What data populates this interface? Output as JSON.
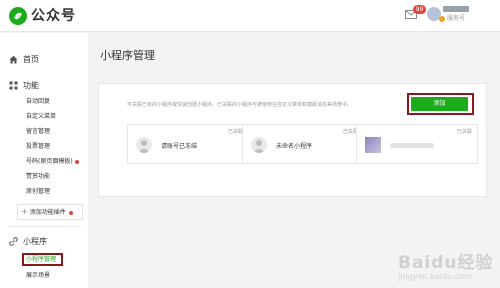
{
  "header": {
    "brand": "公众号",
    "mail_badge": "99",
    "account_type": "服务号"
  },
  "sidebar": {
    "home": "首页",
    "functions": {
      "title": "功能",
      "items": [
        "自动回复",
        "自定义菜单",
        "留言管理",
        "投票管理",
        "号码(原页面模板)",
        "赞赏功能",
        "原创管理"
      ]
    },
    "add_plugin": "添加功能插件",
    "miniprogram": {
      "title": "小程序",
      "items": [
        "小程序管理",
        "展示场景"
      ]
    }
  },
  "main": {
    "title": "小程序管理",
    "description": "可关联已有的小程序或快速创建小程序。已关联的小程序可被使用在自定义菜单和模版消息等场景中。",
    "add_button": "添加",
    "cards": [
      {
        "status": "已关联",
        "name": "请账号已冻结"
      },
      {
        "status": "已关联",
        "name": "未命名小程序"
      },
      {
        "status": "已关联"
      }
    ]
  },
  "watermark": {
    "text": "Baidu经验",
    "url": "jingyan.baidu.com"
  },
  "colors": {
    "accent": "#1aad19",
    "highlight_border": "#8a1919",
    "badge": "#e64340"
  }
}
